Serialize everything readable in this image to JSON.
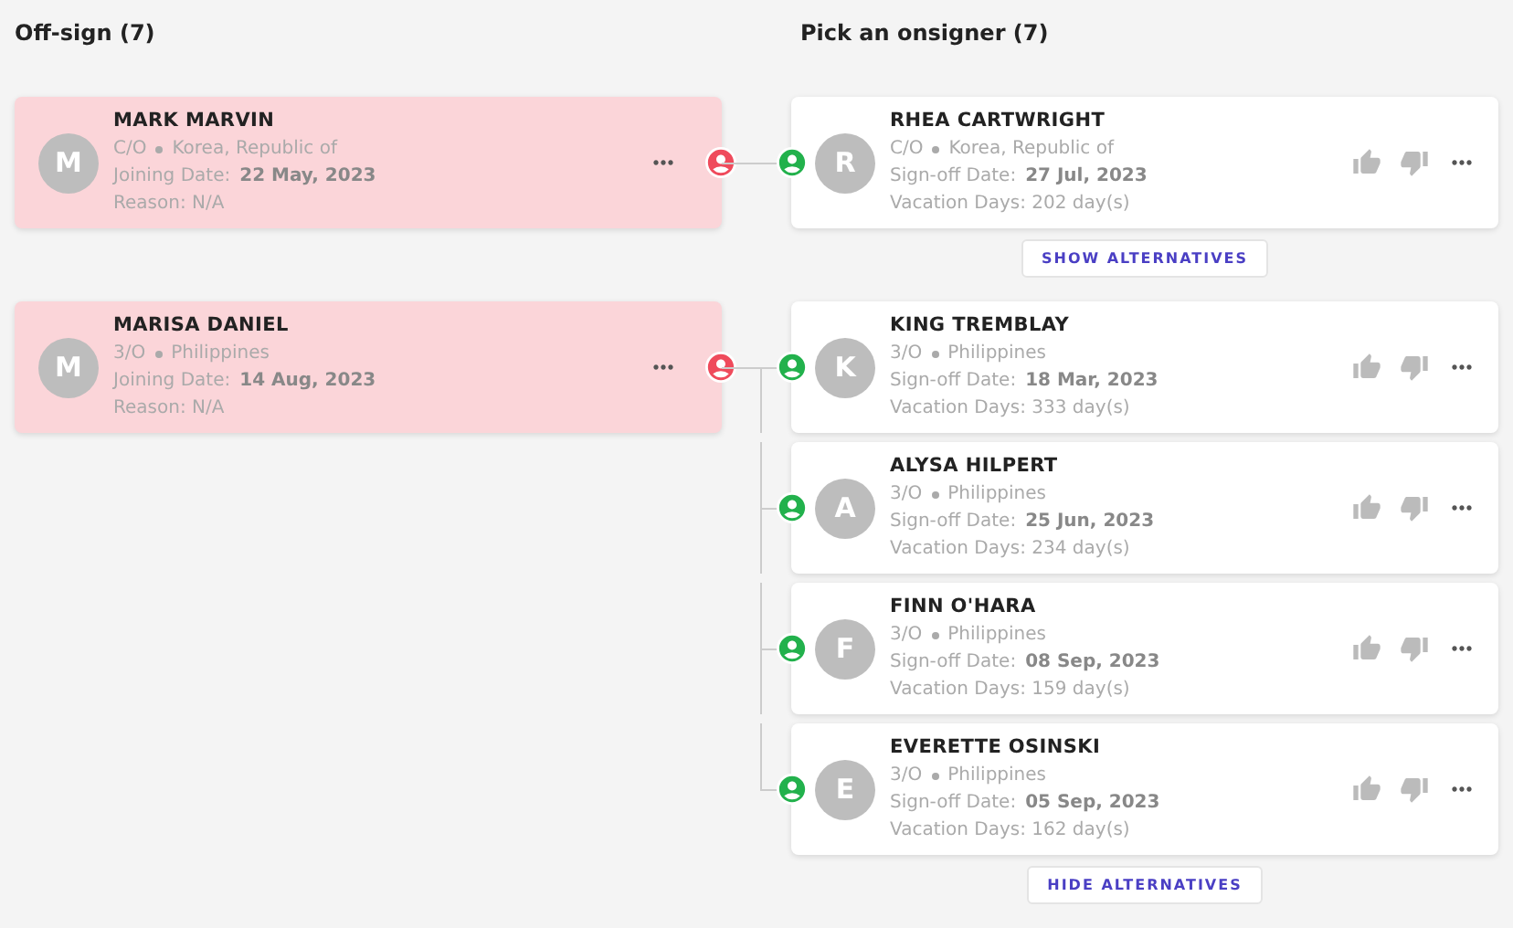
{
  "headings": {
    "offsign": "Off-sign (7)",
    "onsign": "Pick an onsigner (7)"
  },
  "groups": [
    {
      "offsigner": {
        "initial": "M",
        "name": "MARK MARVIN",
        "rank": "C/O",
        "country": "Korea, Republic of",
        "date_label": "Joining Date:",
        "date": "22 May, 2023",
        "reason": "Reason: N/A"
      },
      "onsigners": [
        {
          "initial": "R",
          "name": "RHEA CARTWRIGHT",
          "rank": "C/O",
          "country": "Korea, Republic of",
          "date_label": "Sign-off Date:",
          "date": "27 Jul, 2023",
          "vacation": "Vacation Days: 202 day(s)"
        }
      ],
      "toggle": "SHOW ALTERNATIVES"
    },
    {
      "offsigner": {
        "initial": "M",
        "name": "MARISA DANIEL",
        "rank": "3/O",
        "country": "Philippines",
        "date_label": "Joining Date:",
        "date": "14 Aug, 2023",
        "reason": "Reason: N/A"
      },
      "onsigners": [
        {
          "initial": "K",
          "name": "KING TREMBLAY",
          "rank": "3/O",
          "country": "Philippines",
          "date_label": "Sign-off Date:",
          "date": "18 Mar, 2023",
          "vacation": "Vacation Days: 333 day(s)"
        },
        {
          "initial": "A",
          "name": "ALYSA HILPERT",
          "rank": "3/O",
          "country": "Philippines",
          "date_label": "Sign-off Date:",
          "date": "25 Jun, 2023",
          "vacation": "Vacation Days: 234 day(s)"
        },
        {
          "initial": "F",
          "name": "FINN O'HARA",
          "rank": "3/O",
          "country": "Philippines",
          "date_label": "Sign-off Date:",
          "date": "08 Sep, 2023",
          "vacation": "Vacation Days: 159 day(s)"
        },
        {
          "initial": "E",
          "name": "EVERETTE OSINSKI",
          "rank": "3/O",
          "country": "Philippines",
          "date_label": "Sign-off Date:",
          "date": "05 Sep, 2023",
          "vacation": "Vacation Days: 162 day(s)"
        }
      ],
      "toggle": "HIDE ALTERNATIVES"
    }
  ]
}
